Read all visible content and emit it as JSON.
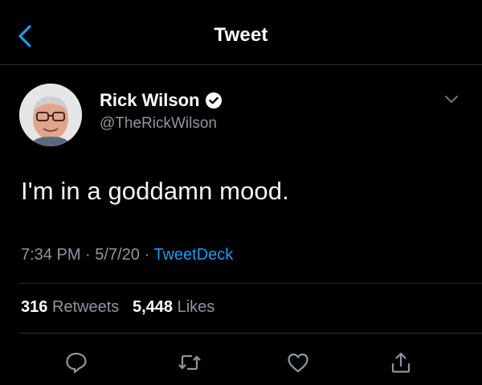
{
  "header": {
    "title": "Tweet",
    "back_icon": "chevron-left-icon"
  },
  "colors": {
    "accent": "#1d9bf0",
    "background": "#000000",
    "muted": "#8d96a0",
    "divider": "#2a2a2a"
  },
  "tweet": {
    "author_name": "Rick Wilson",
    "author_handle": "@TheRickWilson",
    "verified_icon": "verified-badge-icon",
    "text": "I'm in a goddamn mood.",
    "time": "7:34 PM",
    "date": "5/7/20",
    "source": "TweetDeck",
    "separator": "·"
  },
  "stats": {
    "retweets_count": "316",
    "retweets_label": "Retweets",
    "likes_count": "5,448",
    "likes_label": "Likes"
  },
  "actions": [
    "reply-icon",
    "retweet-icon",
    "like-icon",
    "share-icon"
  ]
}
